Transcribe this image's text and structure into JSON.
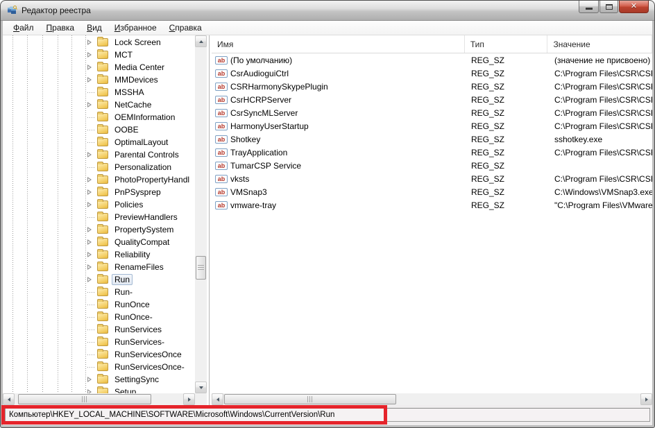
{
  "window": {
    "title": "Редактор реестра",
    "controls": [
      "minimize",
      "maximize",
      "close"
    ]
  },
  "menu": {
    "items": [
      "Файл",
      "Правка",
      "Вид",
      "Избранное",
      "Справка"
    ]
  },
  "tree": {
    "selected": "Run",
    "items": [
      {
        "label": "Lock Screen",
        "expandable": true
      },
      {
        "label": "MCT",
        "expandable": true
      },
      {
        "label": "Media Center",
        "expandable": true
      },
      {
        "label": "MMDevices",
        "expandable": true
      },
      {
        "label": "MSSHA",
        "expandable": false
      },
      {
        "label": "NetCache",
        "expandable": true
      },
      {
        "label": "OEMInformation",
        "expandable": false
      },
      {
        "label": "OOBE",
        "expandable": false
      },
      {
        "label": "OptimalLayout",
        "expandable": false
      },
      {
        "label": "Parental Controls",
        "expandable": true
      },
      {
        "label": "Personalization",
        "expandable": false
      },
      {
        "label": "PhotoPropertyHandl",
        "expandable": true
      },
      {
        "label": "PnPSysprep",
        "expandable": true
      },
      {
        "label": "Policies",
        "expandable": true
      },
      {
        "label": "PreviewHandlers",
        "expandable": false
      },
      {
        "label": "PropertySystem",
        "expandable": true
      },
      {
        "label": "QualityCompat",
        "expandable": true
      },
      {
        "label": "Reliability",
        "expandable": true
      },
      {
        "label": "RenameFiles",
        "expandable": true
      },
      {
        "label": "Run",
        "expandable": true
      },
      {
        "label": "Run-",
        "expandable": false
      },
      {
        "label": "RunOnce",
        "expandable": false
      },
      {
        "label": "RunOnce-",
        "expandable": false
      },
      {
        "label": "RunServices",
        "expandable": false
      },
      {
        "label": "RunServices-",
        "expandable": false
      },
      {
        "label": "RunServicesOnce",
        "expandable": false
      },
      {
        "label": "RunServicesOnce-",
        "expandable": false
      },
      {
        "label": "SettingSync",
        "expandable": true
      },
      {
        "label": "Setup",
        "expandable": true
      }
    ]
  },
  "list": {
    "columns": [
      "Имя",
      "Тип",
      "Значение"
    ],
    "string_icon": "ab",
    "rows": [
      {
        "name": "(По умолчанию)",
        "type": "REG_SZ",
        "value": "(значение не присвоено)"
      },
      {
        "name": "CsrAudioguiCtrl",
        "type": "REG_SZ",
        "value": "C:\\Program Files\\CSR\\CSR"
      },
      {
        "name": "CSRHarmonySkypePlugin",
        "type": "REG_SZ",
        "value": "C:\\Program Files\\CSR\\CSR"
      },
      {
        "name": "CsrHCRPServer",
        "type": "REG_SZ",
        "value": "C:\\Program Files\\CSR\\CSR"
      },
      {
        "name": "CsrSyncMLServer",
        "type": "REG_SZ",
        "value": "C:\\Program Files\\CSR\\CSR"
      },
      {
        "name": "HarmonyUserStartup",
        "type": "REG_SZ",
        "value": "C:\\Program Files\\CSR\\CSR"
      },
      {
        "name": "Shotkey",
        "type": "REG_SZ",
        "value": "sshotkey.exe"
      },
      {
        "name": "TrayApplication",
        "type": "REG_SZ",
        "value": "C:\\Program Files\\CSR\\CSR"
      },
      {
        "name": "TumarCSP Service",
        "type": "REG_SZ",
        "value": ""
      },
      {
        "name": "vksts",
        "type": "REG_SZ",
        "value": "C:\\Program Files\\CSR\\CSR"
      },
      {
        "name": "VMSnap3",
        "type": "REG_SZ",
        "value": "C:\\Windows\\VMSnap3.exe"
      },
      {
        "name": "vmware-tray",
        "type": "REG_SZ",
        "value": "\"C:\\Program Files\\VMware"
      }
    ]
  },
  "status": {
    "path": "Компьютер\\HKEY_LOCAL_MACHINE\\SOFTWARE\\Microsoft\\Windows\\CurrentVersion\\Run"
  },
  "colors": {
    "annotation_red": "#e5242b",
    "selection_bg": "#e8eff7",
    "selection_border": "#a3b9d3",
    "folder_yellow": "#f3cd62",
    "close_button_red": "#bc4430"
  }
}
